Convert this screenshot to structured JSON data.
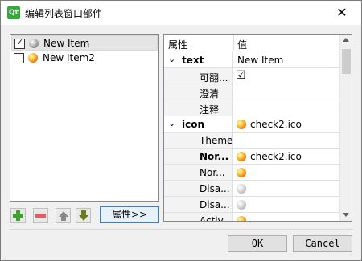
{
  "window": {
    "title": "编辑列表窗口部件",
    "app_icon_label": "Qt",
    "close_glyph": "✕"
  },
  "list": {
    "items": [
      {
        "label": "New Item",
        "checked": true,
        "icon": "gray-gem-icon"
      },
      {
        "label": "New Item2",
        "checked": false,
        "icon": "orange-gem-icon"
      }
    ]
  },
  "toolbar": {
    "properties_label": "属性>>"
  },
  "property_grid": {
    "headers": {
      "property": "属性",
      "value": "值"
    },
    "rows": [
      {
        "name": "text",
        "value": "New Item",
        "bold": true,
        "group": true,
        "expander": "⌄"
      },
      {
        "name": "可翻...",
        "value": "☑",
        "child": true
      },
      {
        "name": "澄清",
        "value": "",
        "child": true
      },
      {
        "name": "注释",
        "value": "",
        "child": true
      },
      {
        "name": "icon",
        "value": "check2.ico",
        "bold": true,
        "group": true,
        "expander": "⌄",
        "icon": "orange-gem-icon"
      },
      {
        "name": "Theme",
        "value": "",
        "child": true
      },
      {
        "name": "Nor...",
        "value": "check2.ico",
        "bold": true,
        "child": true,
        "icon": "orange-gem-icon"
      },
      {
        "name": "Nor...",
        "value": "",
        "child": true,
        "icon": "orange-gem-icon"
      },
      {
        "name": "Disa...",
        "value": "",
        "child": true,
        "icon": "gray-gem-icon"
      },
      {
        "name": "Disa...",
        "value": "",
        "child": true,
        "icon": "gray-gem-icon"
      },
      {
        "name": "Activ...",
        "value": "",
        "child": true,
        "icon": "orange-gem-icon"
      }
    ]
  },
  "buttons": {
    "ok": "OK",
    "cancel": "Cancel"
  }
}
